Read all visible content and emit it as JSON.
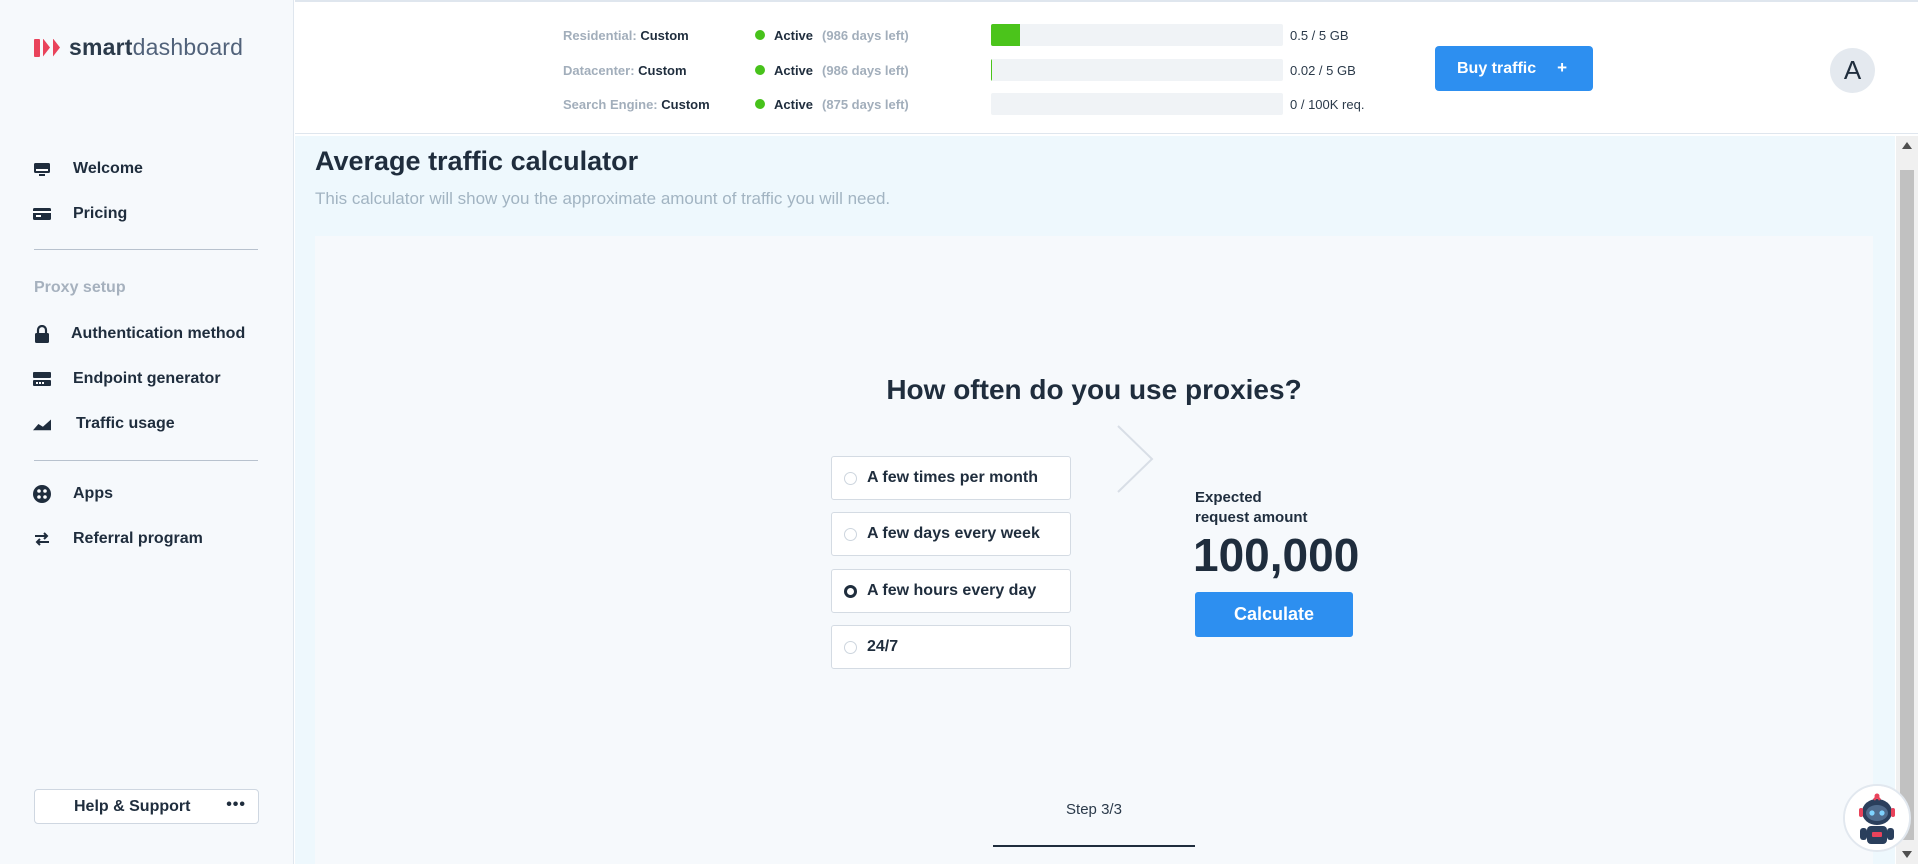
{
  "brand": {
    "name_part1": "smart",
    "name_part2": "dashboard",
    "accent_color": "#e9435b"
  },
  "sidebar": {
    "items_top": [
      {
        "label": "Welcome",
        "icon": "monitor-icon"
      },
      {
        "label": "Pricing",
        "icon": "credit-card-icon"
      }
    ],
    "section_title": "Proxy setup",
    "items_proxy": [
      {
        "label": "Authentication method",
        "icon": "lock-icon"
      },
      {
        "label": "Endpoint generator",
        "icon": "server-icon"
      },
      {
        "label": "Traffic usage",
        "icon": "chart-area-icon"
      }
    ],
    "items_bottom": [
      {
        "label": "Apps",
        "icon": "apps-grid-icon"
      },
      {
        "label": "Referral program",
        "icon": "transfer-icon"
      }
    ],
    "help_label": "Help & Support",
    "help_more": "•••"
  },
  "header": {
    "subscriptions": [
      {
        "name": "Residential:",
        "plan": "Custom",
        "status": "Active",
        "days": "(986 days left)",
        "usage": "0.5 / 5 GB",
        "usage_fraction": 0.1
      },
      {
        "name": "Datacenter:",
        "plan": "Custom",
        "status": "Active",
        "days": "(986 days left)",
        "usage": "0.02 / 5 GB",
        "usage_fraction": 0.004
      },
      {
        "name": "Search Engine:",
        "plan": "Custom",
        "status": "Active",
        "days": "(875 days left)",
        "usage": "0 / 100K req.",
        "usage_fraction": 0
      }
    ],
    "buy_label": "Buy traffic",
    "buy_plus": "+",
    "avatar_letter": "A",
    "status_color": "#47c21b",
    "button_color": "#2d8ff0"
  },
  "main": {
    "title": "Average traffic calculator",
    "subtitle": "This calculator will show you the approximate amount of traffic you will need.",
    "question": "How often do you use proxies?",
    "options": [
      {
        "label": "A few times per month",
        "selected": false
      },
      {
        "label": "A few days every week",
        "selected": false
      },
      {
        "label": "A few hours every day",
        "selected": true
      },
      {
        "label": "24/7",
        "selected": false
      }
    ],
    "expected_label_line1": "Expected",
    "expected_label_line2": "request amount",
    "expected_value": "100,000",
    "calculate_label": "Calculate",
    "step": "Step 3/3"
  }
}
